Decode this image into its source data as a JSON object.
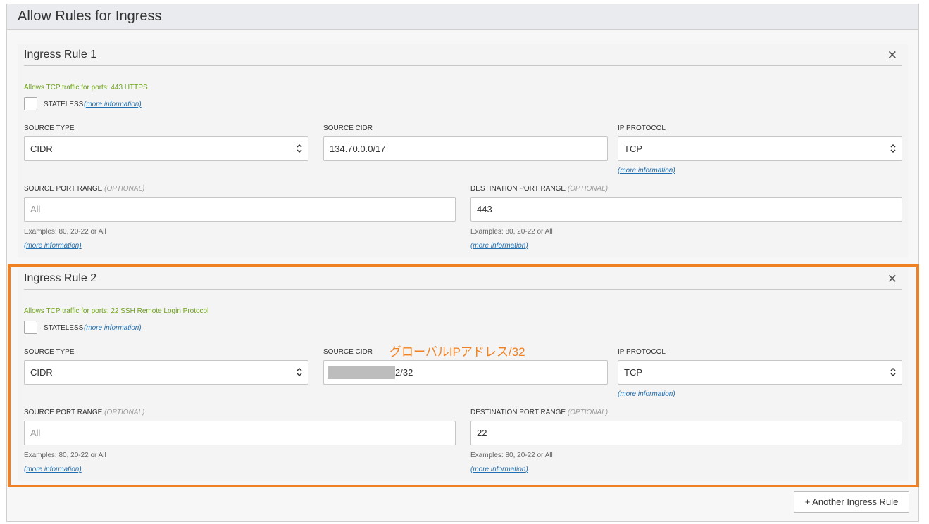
{
  "panel": {
    "title": "Allow Rules for Ingress"
  },
  "rules": [
    {
      "title": "Ingress Rule 1",
      "description": "Allows TCP traffic for ports: 443 HTTPS",
      "stateless_label": "STATELESS",
      "more_info": "(more information)",
      "source_type_label": "SOURCE TYPE",
      "source_type_value": "CIDR",
      "source_cidr_label": "SOURCE CIDR",
      "source_cidr_value": "134.70.0.0/17",
      "ip_protocol_label": "IP PROTOCOL",
      "ip_protocol_value": "TCP",
      "source_port_label": "SOURCE PORT RANGE",
      "source_port_placeholder": "All",
      "dest_port_label": "DESTINATION PORT RANGE",
      "dest_port_value": "443",
      "optional": "(OPTIONAL)",
      "examples": "Examples: 80, 20-22 or All"
    },
    {
      "title": "Ingress Rule 2",
      "description": "Allows TCP traffic for ports: 22 SSH Remote Login Protocol",
      "stateless_label": "STATELESS",
      "more_info": "(more information)",
      "source_type_label": "SOURCE TYPE",
      "source_type_value": "CIDR",
      "source_cidr_label": "SOURCE CIDR",
      "source_cidr_value": "2/32",
      "ip_protocol_label": "IP PROTOCOL",
      "ip_protocol_value": "TCP",
      "source_port_label": "SOURCE PORT RANGE",
      "source_port_placeholder": "All",
      "dest_port_label": "DESTINATION PORT RANGE",
      "dest_port_value": "22",
      "optional": "(OPTIONAL)",
      "examples": "Examples: 80, 20-22 or All"
    }
  ],
  "annotation": "グローバルIPアドレス/32",
  "add_button": "+ Another Ingress Rule",
  "colors": {
    "highlight": "#f08122",
    "description": "#6fa31c",
    "link": "#1f6fb2"
  }
}
